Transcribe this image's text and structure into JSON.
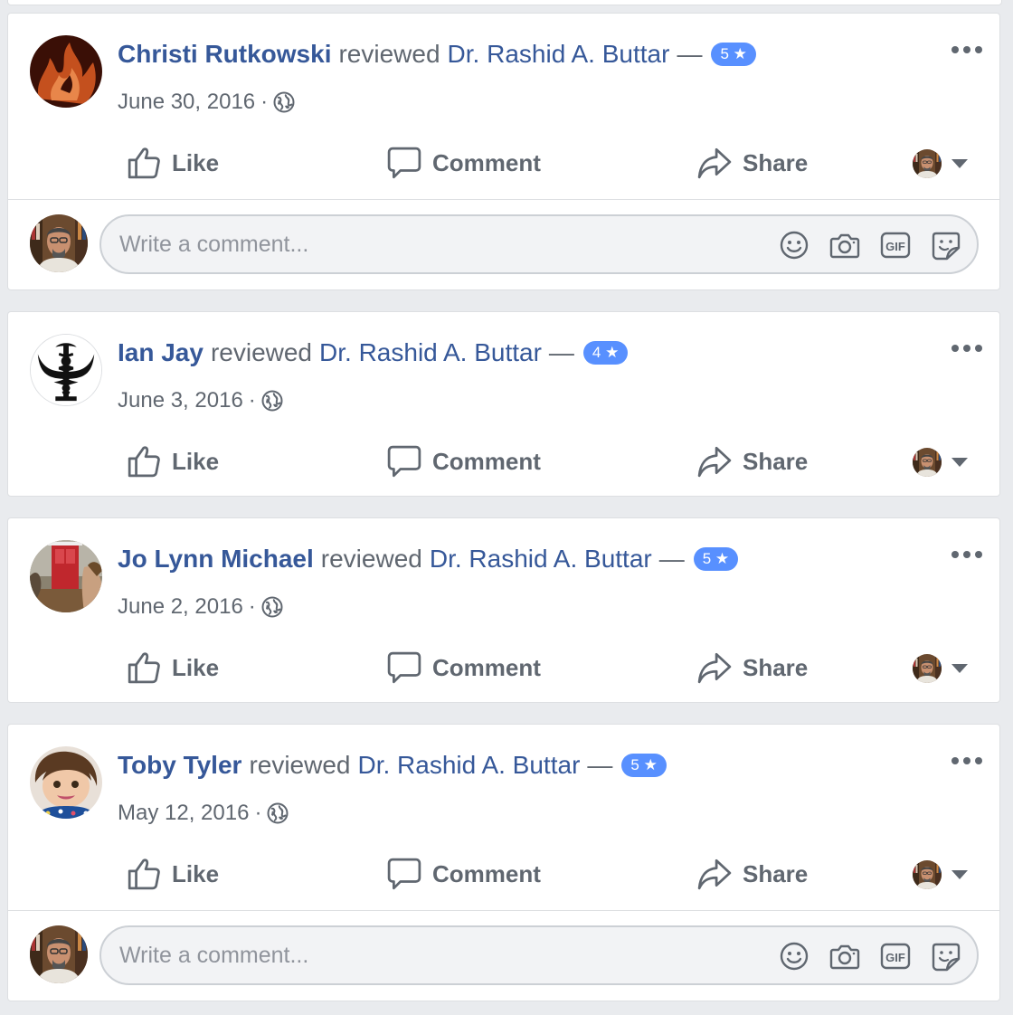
{
  "common": {
    "verb": "reviewed",
    "page_name": "Dr. Rashid A. Buttar",
    "dash": "—",
    "dot": "·",
    "like_label": "Like",
    "comment_label": "Comment",
    "share_label": "Share",
    "comment_placeholder": "Write a comment..."
  },
  "colors": {
    "link": "#365899",
    "badge": "#5890ff",
    "text_secondary": "#606770",
    "background": "#e9ebee"
  },
  "reviews": [
    {
      "reviewer": "Christi Rutkowski",
      "rating": "5 ★",
      "date": "June 30, 2016",
      "avatar_icon": "flame-avatar",
      "has_comment_box": true
    },
    {
      "reviewer": "Ian Jay",
      "rating": "4 ★",
      "date": "June 3, 2016",
      "avatar_icon": "caduceus-avatar",
      "has_comment_box": false
    },
    {
      "reviewer": "Jo Lynn Michael",
      "rating": "5 ★",
      "date": "June 2, 2016",
      "avatar_icon": "red-door-avatar",
      "has_comment_box": false
    },
    {
      "reviewer": "Toby Tyler",
      "rating": "5 ★",
      "date": "May 12, 2016",
      "avatar_icon": "child-photo-avatar",
      "has_comment_box": true
    }
  ]
}
